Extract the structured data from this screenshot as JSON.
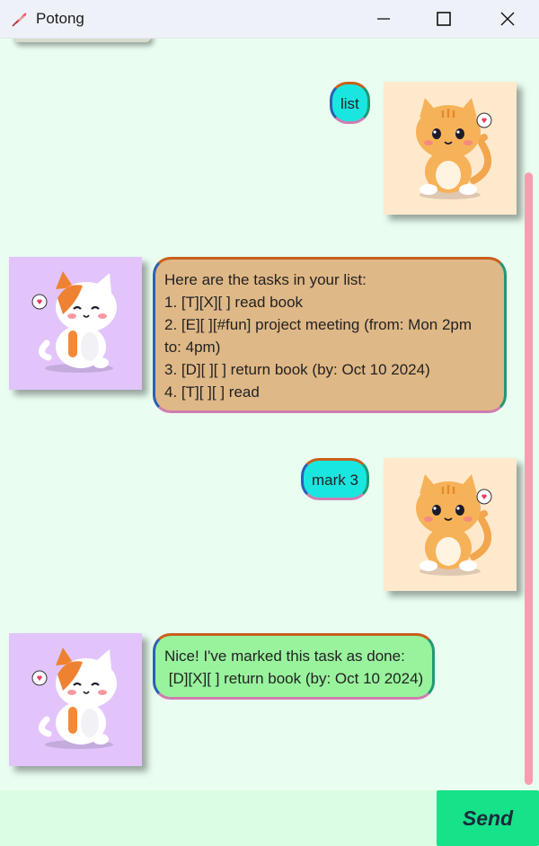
{
  "window": {
    "title": "Potong",
    "icon": "feather-icon",
    "controls": [
      "minimize-icon",
      "maximize-icon",
      "close-icon"
    ]
  },
  "messages": [
    {
      "sender": "user",
      "text": "list",
      "avatar": "orange-cat-avatar"
    },
    {
      "sender": "bot",
      "text": "Here are the tasks in your list:\n1. [T][X][ ] read book\n2. [E][ ][#fun] project meeting (from: Mon 2pm\nto: 4pm)\n3. [D][ ][ ] return book (by: Oct 10 2024)\n4. [T][ ][ ] read",
      "avatar": "calico-cat-avatar"
    },
    {
      "sender": "user",
      "text": "mark 3",
      "avatar": "orange-cat-avatar"
    },
    {
      "sender": "bot",
      "text": "Nice! I've marked this task as done:\n [D][X][ ] return book (by: Oct 10 2024)",
      "avatar": "calico-cat-avatar"
    }
  ],
  "input": {
    "value": "",
    "placeholder": ""
  },
  "send_button": {
    "label": "Send"
  },
  "colors": {
    "background": "#e9fdf0",
    "user_bubble": "#1ae6e0",
    "bot_list_bubble": "#dfb887",
    "bot_done_bubble": "#98f39c",
    "user_avatar_bg": "#ffe9cd",
    "bot_avatar_bg": "#e2c4fb",
    "send_button": "#16e28a",
    "scrollbar": "#fa9db0"
  }
}
